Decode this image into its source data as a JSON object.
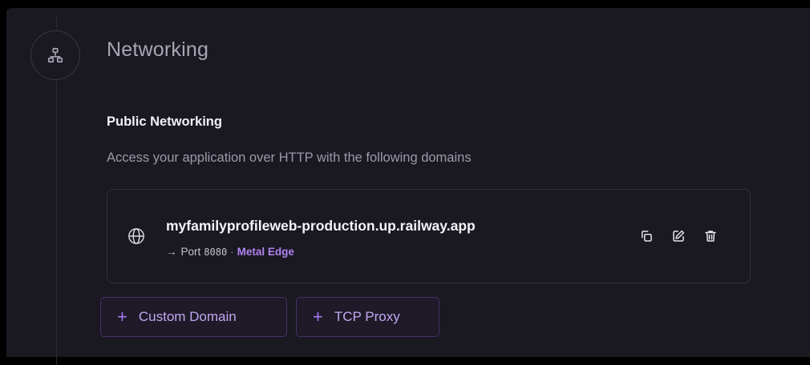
{
  "section": {
    "icon": "network-icon",
    "title": "Networking"
  },
  "public_networking": {
    "title": "Public Networking",
    "description": "Access your application over HTTP with the following domains",
    "domains": [
      {
        "icon": "globe-icon",
        "host": "myfamilyprofileweb-production.up.railway.app",
        "port_arrow": "→",
        "port_label": "Port",
        "port_value": "8080",
        "separator": "·",
        "edge_label": "Metal Edge",
        "actions": [
          "copy-icon",
          "edit-icon",
          "trash-icon"
        ]
      }
    ]
  },
  "buttons": {
    "custom_domain": {
      "plus": "+",
      "label": "Custom Domain"
    },
    "tcp_proxy": {
      "plus": "+",
      "label": "TCP Proxy"
    }
  },
  "colors": {
    "background": "#1a1821",
    "accent": "#b083f0",
    "button_border": "#48306a"
  }
}
